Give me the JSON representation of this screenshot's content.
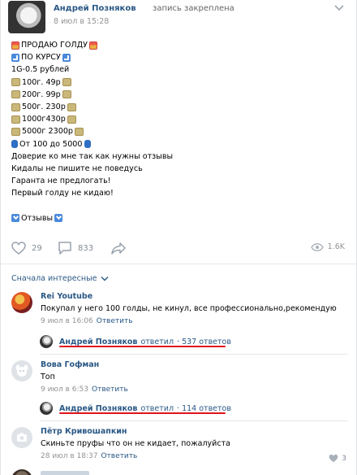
{
  "post": {
    "author": "Андрей Позняков",
    "pinned_label": "запись закреплена",
    "date": "8 июл в 15:28",
    "lines": [
      {
        "pre": "gift",
        "text": "ПРОДАЮ ГОЛДУ",
        "post": "gift"
      },
      {
        "pre": "arrow-dr",
        "text": "ПО КУРСУ",
        "post": "arrow-dr"
      },
      {
        "pre": "",
        "text": "1G-0.5 рублей",
        "post": ""
      },
      {
        "pre": "money",
        "text": "100г. 49р",
        "post": "money"
      },
      {
        "pre": "money",
        "text": "200г. 99р",
        "post": "money"
      },
      {
        "pre": "money",
        "text": "500г. 230р",
        "post": "money"
      },
      {
        "pre": "money",
        "text": "1000г430р",
        "post": "money"
      },
      {
        "pre": "money",
        "text": "5000г 2300р",
        "post": "money"
      },
      {
        "pre": "blue",
        "text": "От 100 до 5000",
        "post": "blue"
      },
      {
        "pre": "",
        "text": "Доверие ко мне так как нужны отзывы",
        "post": ""
      },
      {
        "pre": "",
        "text": "Кидалы не пишите не поведусь",
        "post": ""
      },
      {
        "pre": "",
        "text": "Гаранта не предлогать!",
        "post": ""
      },
      {
        "pre": "",
        "text": "Первый голду не кидаю!",
        "post": ""
      },
      {
        "pre": "",
        "text": "",
        "post": ""
      },
      {
        "pre": "down",
        "text": "Отзывы",
        "post": "down"
      }
    ],
    "likes": "29",
    "comments": "833",
    "views": "1.6K"
  },
  "sort_label": "Сначала интересные",
  "comments": [
    {
      "name": "Rei Youtube",
      "text": "Покупал у него 100 голды, не кинул, все профессионально,рекомендую",
      "date": "9 июл в 16:06",
      "reply_label": "Ответить",
      "reply_author": "Андрей Позняков",
      "reply_verb": "ответил",
      "reply_count": "· 537 ответов",
      "likes": ""
    },
    {
      "name": "Вова Гофман",
      "text": "Топ",
      "date": "9 июл в 6:53",
      "reply_label": "Ответить",
      "reply_author": "Андрей Позняков",
      "reply_verb": "ответил",
      "reply_count": "· 114 ответов",
      "likes": ""
    },
    {
      "name": "Пётр Кривошапкин",
      "text": "Скиньте пруфы что он не кидает, пожалуйста",
      "date": "28 июл в 18:37",
      "reply_label": "Ответить",
      "likes": "3"
    }
  ],
  "colors": {
    "link": "#2a5885",
    "muted": "#939393",
    "highlight": "#e0141e"
  }
}
